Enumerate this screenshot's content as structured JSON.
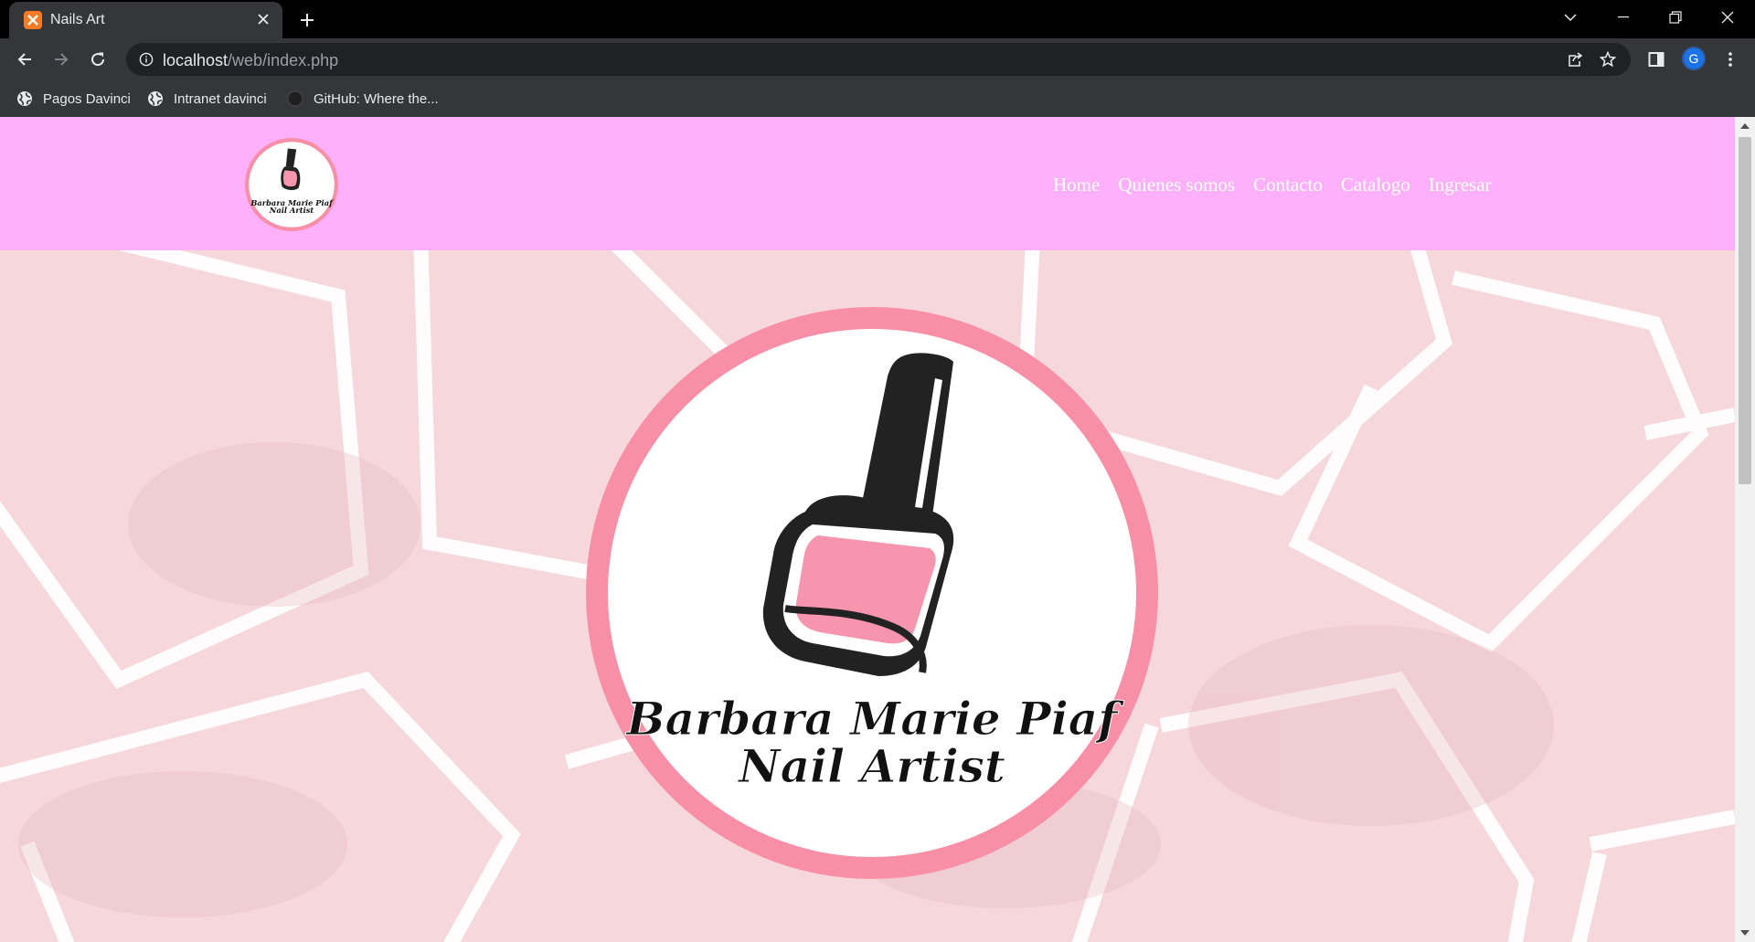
{
  "browser": {
    "tab_title": "Nails Art",
    "url_host": "localhost",
    "url_path": "/web/index.php",
    "profile_initial": "G",
    "bookmarks": [
      {
        "label": "Pagos Davinci",
        "icon": "globe-icon"
      },
      {
        "label": "Intranet davinci",
        "icon": "globe-icon"
      },
      {
        "label": "GitHub: Where the...",
        "icon": "github-icon"
      }
    ]
  },
  "site": {
    "nav": [
      "Home",
      "Quienes somos",
      "Contacto",
      "Catalogo",
      "Ingresar"
    ],
    "logo_text_line1": "Barbara Marie Piaf",
    "logo_text_line2": "Nail Artist"
  },
  "colors": {
    "header_bg": "#ffb0fb",
    "ring": "#f88fa6",
    "polish": "#f695ad",
    "hero_bg": "#f5d7dc"
  }
}
